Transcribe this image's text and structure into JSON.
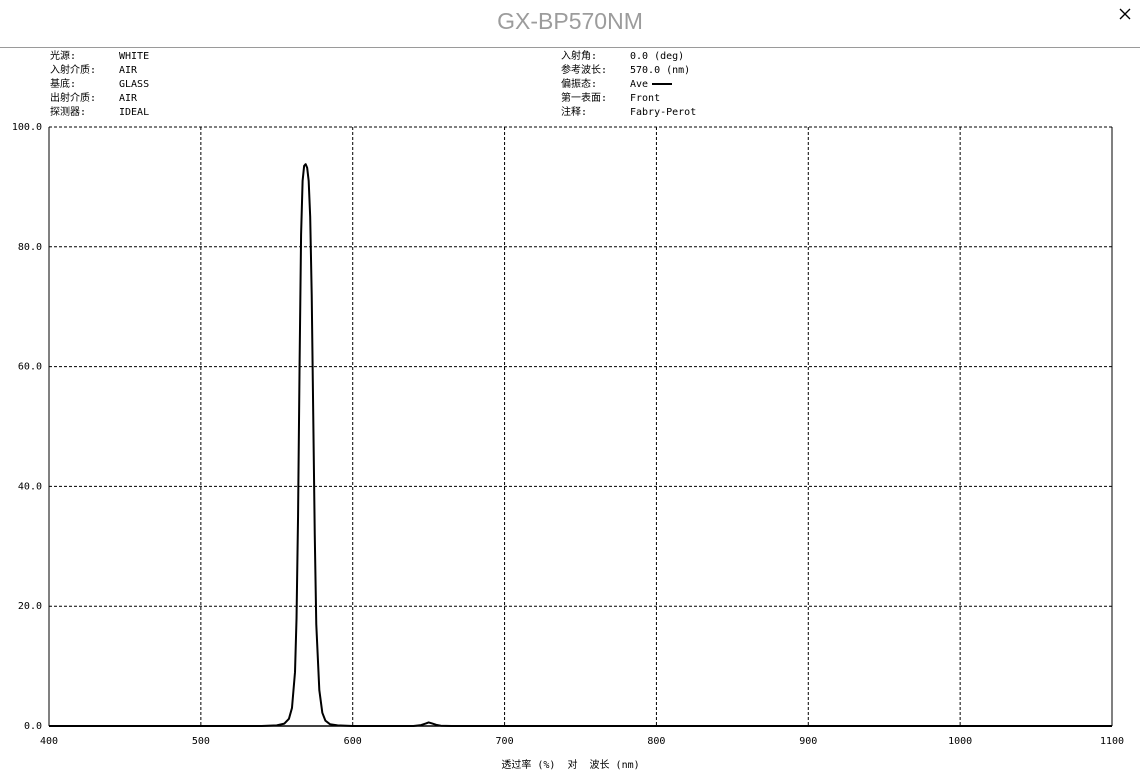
{
  "window": {
    "title": "GX-BP570NM",
    "close_icon": "close-icon"
  },
  "info_left": [
    {
      "key": "光源:",
      "value": "WHITE"
    },
    {
      "key": "入射介质:",
      "value": "AIR"
    },
    {
      "key": "基底:",
      "value": "GLASS"
    },
    {
      "key": "出射介质:",
      "value": "AIR"
    },
    {
      "key": "探测器:",
      "value": "IDEAL"
    }
  ],
  "info_right": [
    {
      "key": "入射角:",
      "value": "0.0 (deg)"
    },
    {
      "key": "参考波长:",
      "value": "570.0 (nm)"
    },
    {
      "key": "偏振态:",
      "value": "Ave"
    },
    {
      "key": "第一表面:",
      "value": "Front"
    },
    {
      "key": "注释:",
      "value": "Fabry-Perot"
    }
  ],
  "chart_data": {
    "type": "line",
    "xlabel": "透过率 (%)  对  波长 (nm)",
    "ylabel": "",
    "xlim": [
      400,
      1100
    ],
    "ylim": [
      0,
      100
    ],
    "x_ticks": [
      400,
      500,
      600,
      700,
      800,
      900,
      1000,
      1100
    ],
    "x_tick_labels": [
      "400",
      "500",
      "600",
      "700",
      "800",
      "900",
      "1000",
      "1100"
    ],
    "y_ticks": [
      0,
      20,
      40,
      60,
      80,
      100
    ],
    "y_tick_labels": [
      "0.0",
      "20.0",
      "40.0",
      "60.0",
      "80.0",
      "100.0"
    ],
    "grid": true,
    "grid_style": "dashed",
    "line_color": "#000000",
    "series": [
      {
        "x": [
          400,
          540,
          550,
          555,
          558,
          560,
          562,
          563,
          564,
          565,
          566,
          567,
          568,
          569,
          570,
          571,
          572,
          573,
          574,
          575,
          576,
          578,
          580,
          582,
          585,
          590,
          600,
          640,
          645,
          648,
          650,
          652,
          655,
          658,
          665,
          700,
          1100
        ],
        "y": [
          0,
          0,
          0.1,
          0.4,
          1.2,
          3,
          9,
          18,
          35,
          60,
          82,
          91,
          93.5,
          93.8,
          93.2,
          91,
          85,
          72,
          52,
          32,
          17,
          6,
          2.2,
          0.9,
          0.3,
          0.1,
          0,
          0,
          0.15,
          0.4,
          0.6,
          0.45,
          0.2,
          0.05,
          0,
          0,
          0
        ]
      }
    ]
  }
}
